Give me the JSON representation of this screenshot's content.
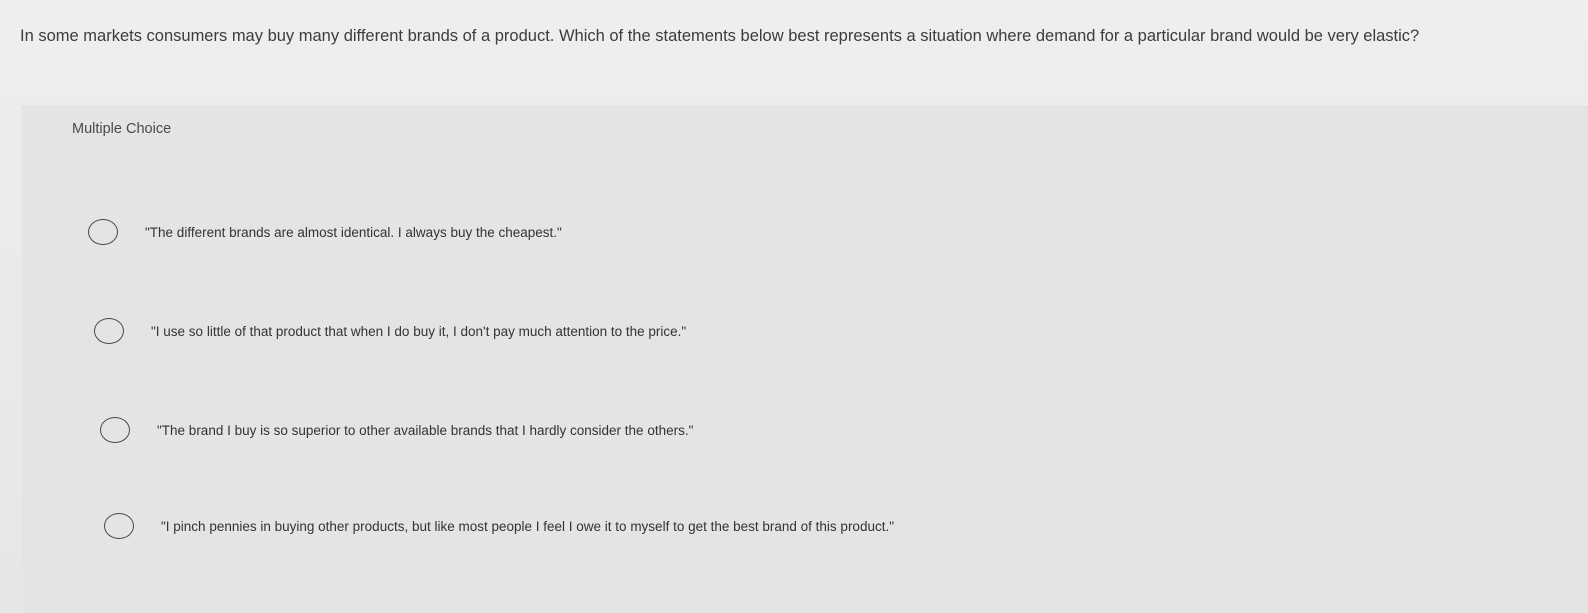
{
  "question": {
    "text": "In some markets consumers may buy many different brands of a product. Which of the statements below best represents a situation where demand for a particular brand would be very elastic?"
  },
  "multiple_choice": {
    "label": "Multiple Choice",
    "options": [
      {
        "text": "\"The different brands are almost identical. I always buy the cheapest.\"",
        "selected": false
      },
      {
        "text": "\"I use so little of that product that when I do buy it, I don't pay much attention to the price.\"",
        "selected": false
      },
      {
        "text": "\"The brand I buy is so superior to other available brands that I hardly consider the others.\"",
        "selected": false
      },
      {
        "text": "\"I pinch pennies in buying other products, but like most people I feel I owe it to myself to get the best brand of this product.\"",
        "selected": false
      }
    ]
  },
  "colors": {
    "background": "#e9e9e9",
    "card": "#e4e4e4",
    "text": "#3a3a3a",
    "radio_border": "#4a4a4a"
  },
  "icons": {
    "radio": "radio-unselected-icon"
  }
}
